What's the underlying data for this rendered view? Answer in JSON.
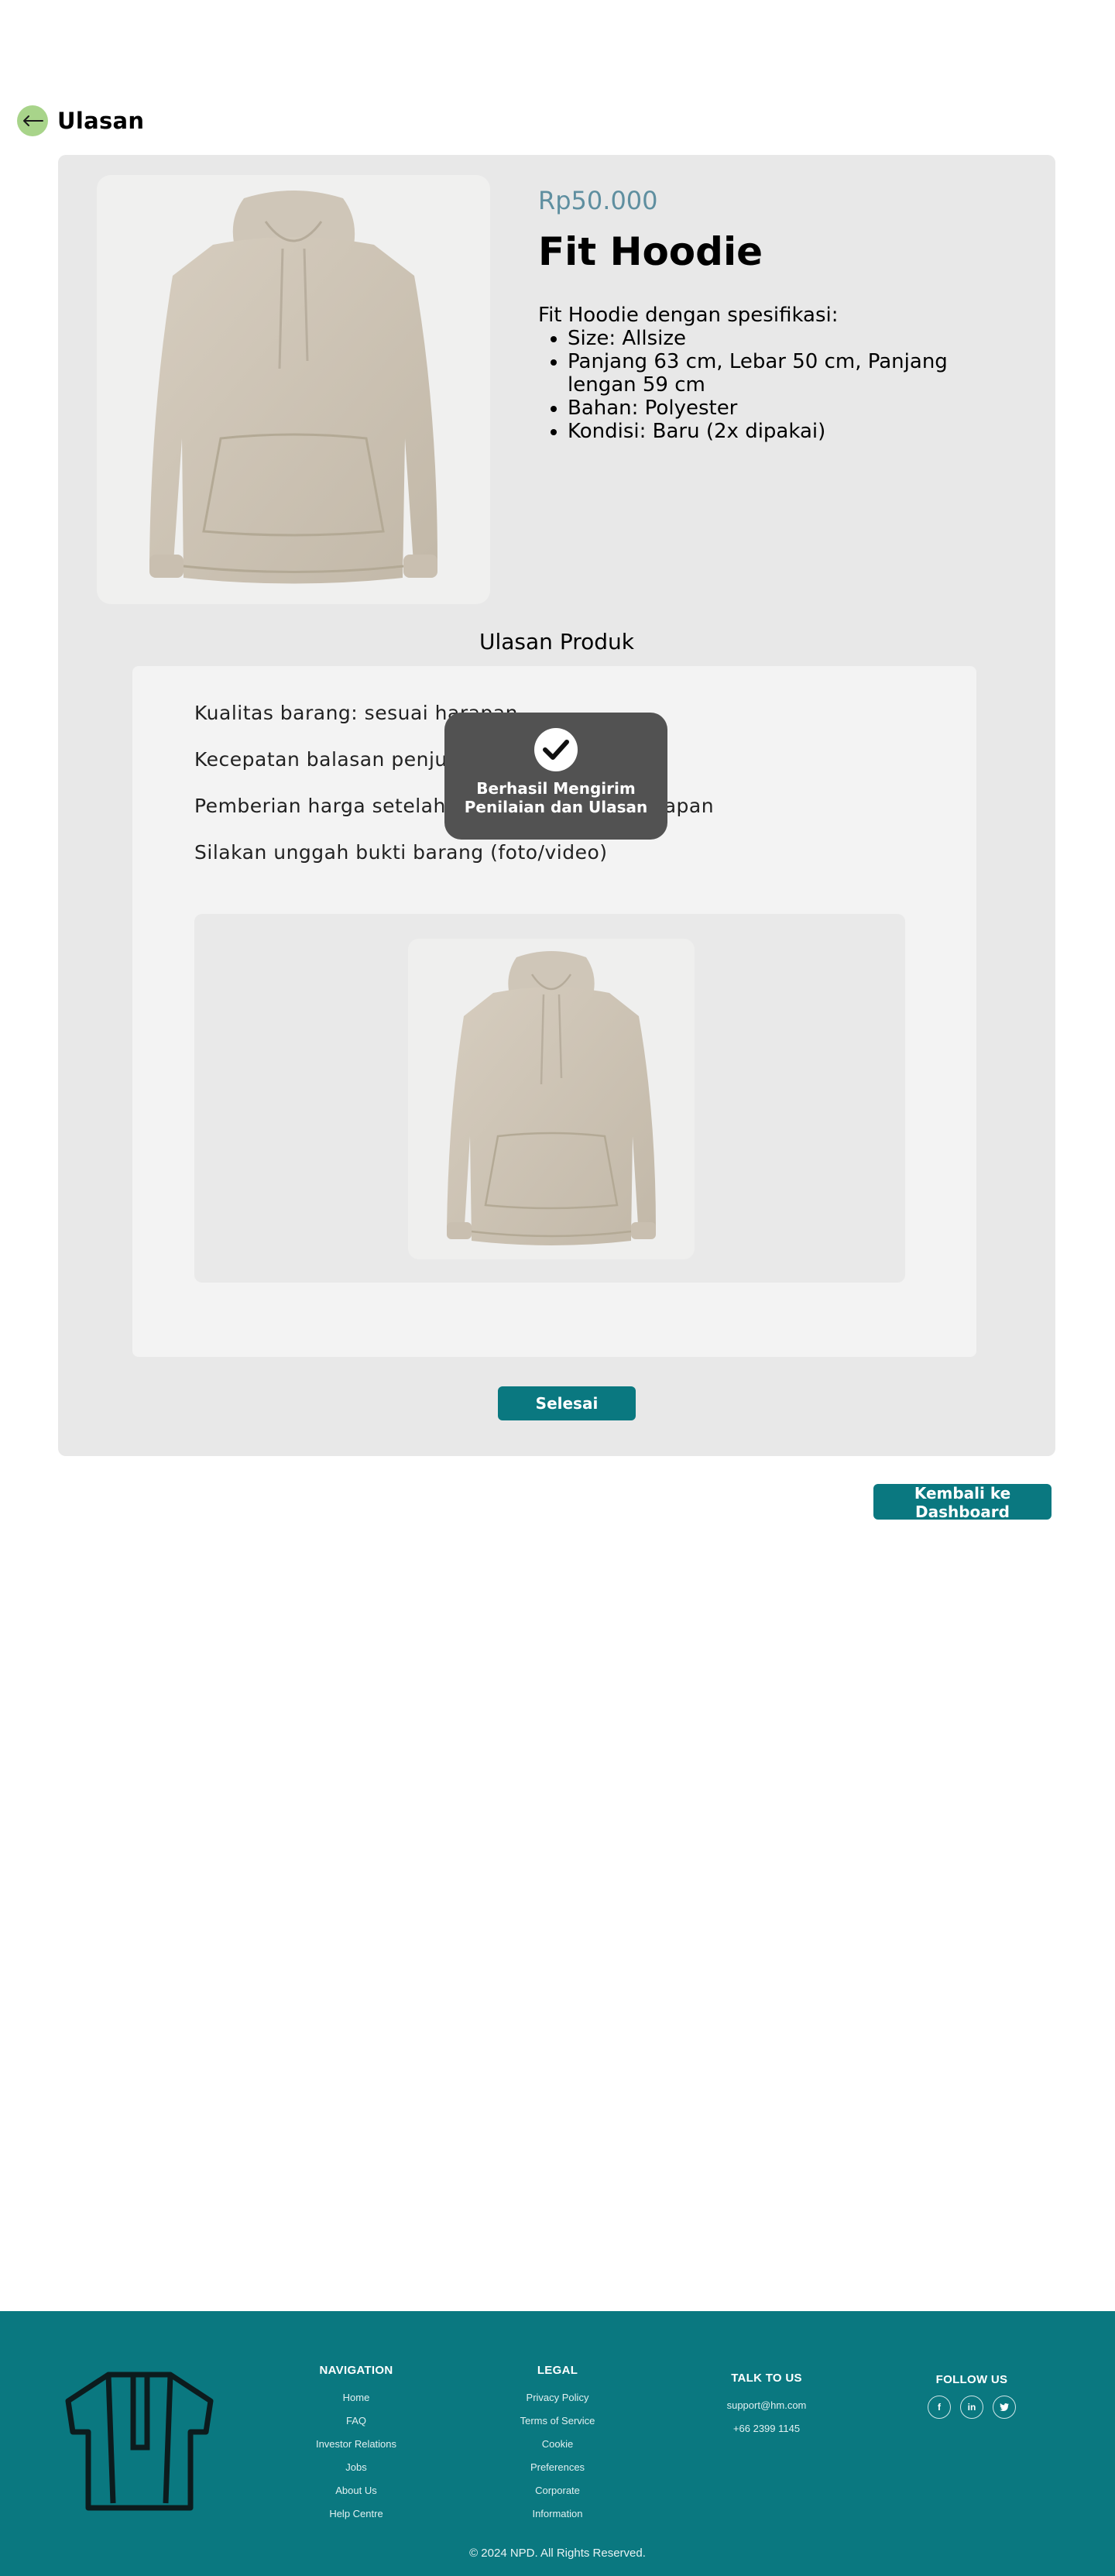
{
  "header": {
    "title": "Ulasan",
    "back_icon": "arrow-left-icon"
  },
  "product": {
    "price": "Rp50.000",
    "name": "Fit Hoodie",
    "description_intro": "Fit Hoodie dengan spesifikasi:",
    "specs": [
      "Size: Allsize",
      "Panjang 63 cm, Lebar 50 cm, Panjang lengan 59 cm",
      "Bahan: Polyester",
      "Kondisi: Baru (2x dipakai)"
    ],
    "image_icon": "hoodie-image"
  },
  "review": {
    "heading": "Ulasan Produk",
    "lines": [
      "Kualitas barang: sesuai harapan",
      "Kecepatan balasan penjual: sangat responsif",
      "Pemberian harga setelah negosiasi: sesuai harapan",
      "Silakan unggah bukti barang (foto/video)"
    ],
    "done_label": "Selesai"
  },
  "toast": {
    "icon": "check-icon",
    "message": "Berhasil Mengirim Penilaian dan Ulasan"
  },
  "dashboard_label": "Kembali ke Dashboard",
  "footer": {
    "logo_icon": "shirt-logo-icon",
    "navigation": {
      "title": "NAVIGATION",
      "items": [
        "Home",
        "FAQ",
        "Investor Relations",
        "Jobs",
        "About Us",
        "Help Centre"
      ]
    },
    "legal": {
      "title": "LEGAL",
      "items": [
        "Privacy Policy",
        "Terms of Service",
        "Cookie",
        "Preferences",
        "Corporate",
        "Information"
      ]
    },
    "talk": {
      "title": "TALK TO US",
      "items": [
        "support@hm.com",
        "+66 2399 1145"
      ]
    },
    "follow": {
      "title": "FOLLOW US",
      "socials": [
        "f",
        "in",
        "t"
      ]
    },
    "copyright": "© 2024 NPD. All Rights Reserved."
  },
  "colors": {
    "accent": "#0a7880",
    "price": "#5f8fa0",
    "card": "#e8e8e8",
    "back_button": "#a8d48a"
  }
}
